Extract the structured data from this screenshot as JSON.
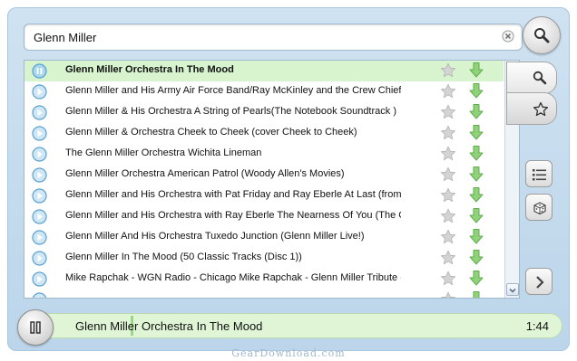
{
  "search": {
    "value": "Glenn Miller"
  },
  "tracks": [
    {
      "title": "Glenn Miller Orchestra In The Mood",
      "state": "playing"
    },
    {
      "title": "Glenn Miller and His Army Air Force Band/Ray McKinley and the Crew Chiefs"
    },
    {
      "title": "Glenn Miller & His Orchestra A String of Pearls(The Notebook Soundtrack )"
    },
    {
      "title": "Glenn Miller & Orchestra Cheek to Cheek (cover Cheek to Cheek)"
    },
    {
      "title": "The Glenn Miller Orchestra Wichita Lineman"
    },
    {
      "title": "Glenn Miller Orchestra American Patrol (Woody Allen's Movies)"
    },
    {
      "title": "Glenn Miller and His Orchestra with Pat Friday and Ray Eberle At Last (from"
    },
    {
      "title": "Glenn Miller and His Orchestra with Ray Eberle The Nearness Of You (The C"
    },
    {
      "title": "Glenn Miller And His Orchestra Tuxedo Junction (Glenn Miller Live!)"
    },
    {
      "title": "Glenn Miller In The Mood (50 Classic Tracks (Disc 1))"
    },
    {
      "title": "Mike Rapchak - WGN Radio - Chicago Mike Rapchak - Glenn Miller Tribute -"
    },
    {
      "title": ""
    }
  ],
  "now_playing": {
    "title": "Glenn Miller Orchestra In The Mood",
    "time": "1:44",
    "progress": 0.48
  },
  "watermark": "GearDownload.com",
  "colors": {
    "accent_green": "#d7f4cf",
    "play_icon_blue": "#5a9fd0",
    "download_green": "#7cc96a"
  }
}
